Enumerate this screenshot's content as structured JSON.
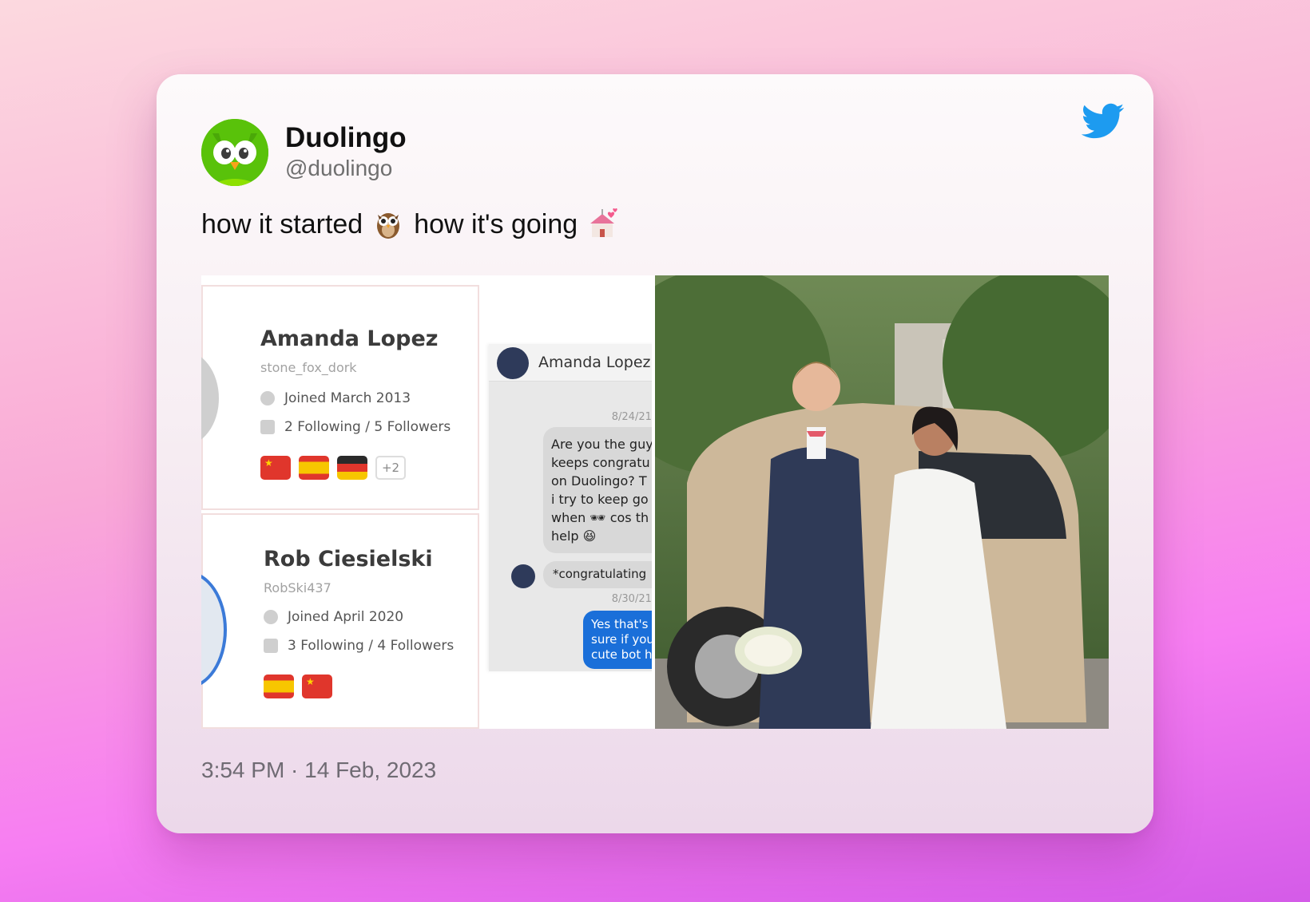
{
  "tweet": {
    "author_name": "Duolingo",
    "author_handle": "@duolingo",
    "text_part1": "how it started",
    "emoji1": "owl-emoji",
    "text_part2": "how it's going",
    "emoji2": "wedding-chapel-emoji",
    "timestamp": "3:54 PM · 14 Feb, 2023"
  },
  "media": {
    "left_image": {
      "profiles": [
        {
          "name": "Amanda Lopez",
          "username": "stone_fox_dork",
          "joined": "Joined March 2013",
          "follow": "2 Following / 5 Followers",
          "flags": [
            "cn",
            "es",
            "de"
          ],
          "more": "+2"
        },
        {
          "name": "Rob Ciesielski",
          "username": "RobSki437",
          "joined": "Joined April 2020",
          "follow": "3 Following / 4 Followers",
          "flags": [
            "es",
            "cn"
          ]
        }
      ],
      "chat": {
        "contact": "Amanda Lopez",
        "date1": "8/24/21,",
        "message_in": "Are you the guy\nkeeps congratu\non Duolingo? T\ni try to keep go\nwhen 🕶 cos th\nhelp 😆",
        "message_in2": "*congratulating",
        "date2": "8/30/21,",
        "message_out": "Yes that's\nsure if you\ncute bot h"
      }
    },
    "right_image": {
      "description_icon": "wedding-photo"
    }
  },
  "colors": {
    "twitter_blue": "#1d9bf0",
    "duo_green": "#59c20a"
  }
}
